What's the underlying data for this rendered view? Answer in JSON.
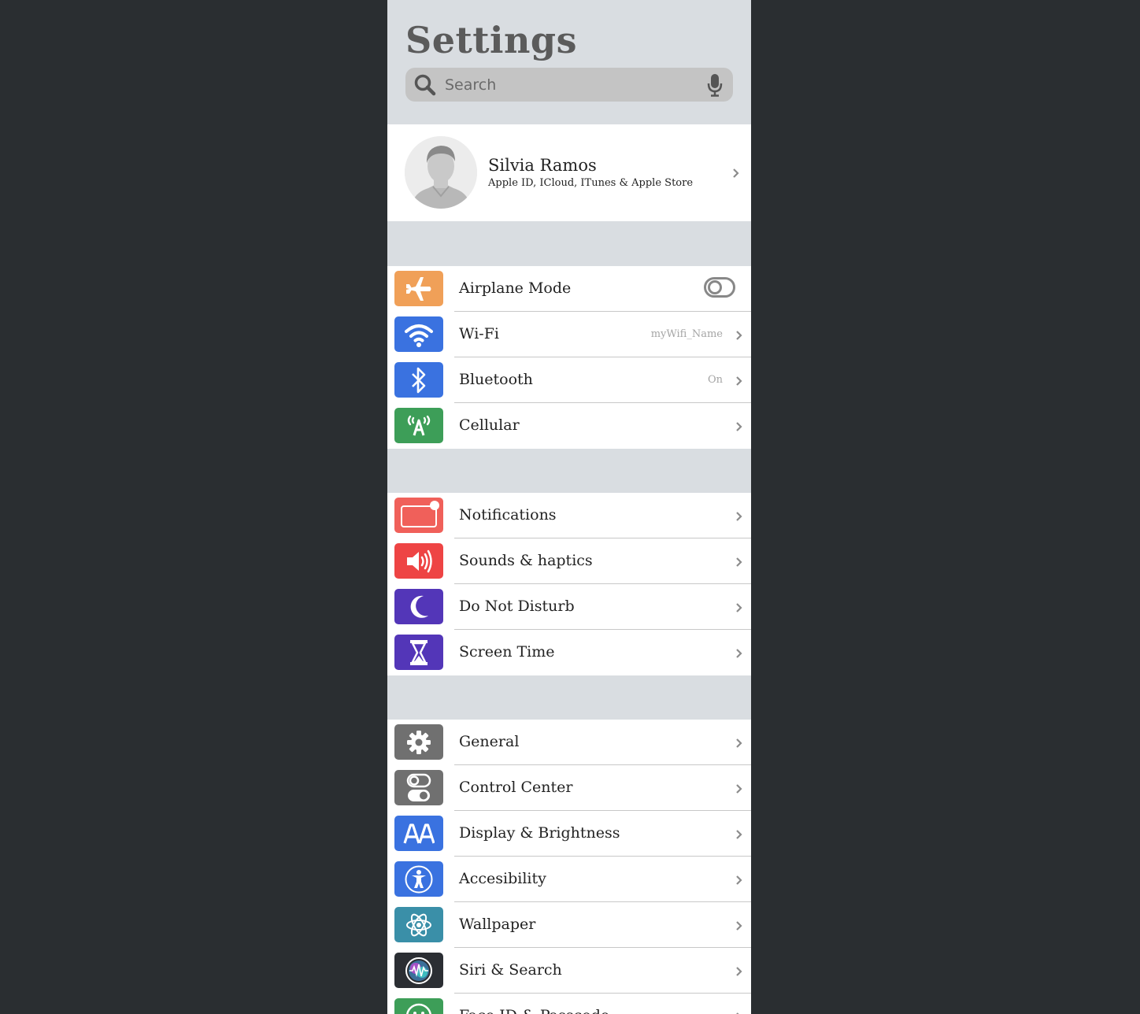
{
  "header": {
    "title": "Settings",
    "search_placeholder": "Search"
  },
  "profile": {
    "name": "Silvia Ramos",
    "subtitle": "Apple ID, ICloud, ITunes & Apple Store"
  },
  "groups": [
    {
      "rows": [
        {
          "label": "Airplane Mode",
          "icon": "airplane-icon",
          "color": "#f0a058",
          "toggle": false
        },
        {
          "label": "Wi-Fi",
          "icon": "wifi-icon",
          "color": "#3a72e0",
          "detail": "myWifi_Name"
        },
        {
          "label": "Bluetooth",
          "icon": "bluetooth-icon",
          "color": "#3a72e0",
          "detail": "On"
        },
        {
          "label": "Cellular",
          "icon": "cellular-icon",
          "color": "#3d9e58"
        }
      ]
    },
    {
      "rows": [
        {
          "label": "Notifications",
          "icon": "notifications-icon",
          "color": "#f0605a"
        },
        {
          "label": "Sounds & haptics",
          "icon": "speaker-icon",
          "color": "#ee4444"
        },
        {
          "label": "Do Not Disturb",
          "icon": "moon-icon",
          "color": "#5336b8"
        },
        {
          "label": "Screen Time",
          "icon": "hourglass-icon",
          "color": "#5336b8"
        }
      ]
    },
    {
      "rows": [
        {
          "label": "General",
          "icon": "gear-icon",
          "color": "#707070"
        },
        {
          "label": "Control Center",
          "icon": "toggles-icon",
          "color": "#707070"
        },
        {
          "label": "Display & Brightness",
          "icon": "text-size-icon",
          "color": "#3a72e0"
        },
        {
          "label": "Accesibility",
          "icon": "accessibility-icon",
          "color": "#3a72e0"
        },
        {
          "label": "Wallpaper",
          "icon": "atom-icon",
          "color": "#3a8fa8"
        },
        {
          "label": "Siri & Search",
          "icon": "siri-icon",
          "color": "#2b2e33"
        },
        {
          "label": "Face ID & Passcode",
          "icon": "face-id-icon",
          "color": "#3d9e58"
        }
      ]
    }
  ]
}
